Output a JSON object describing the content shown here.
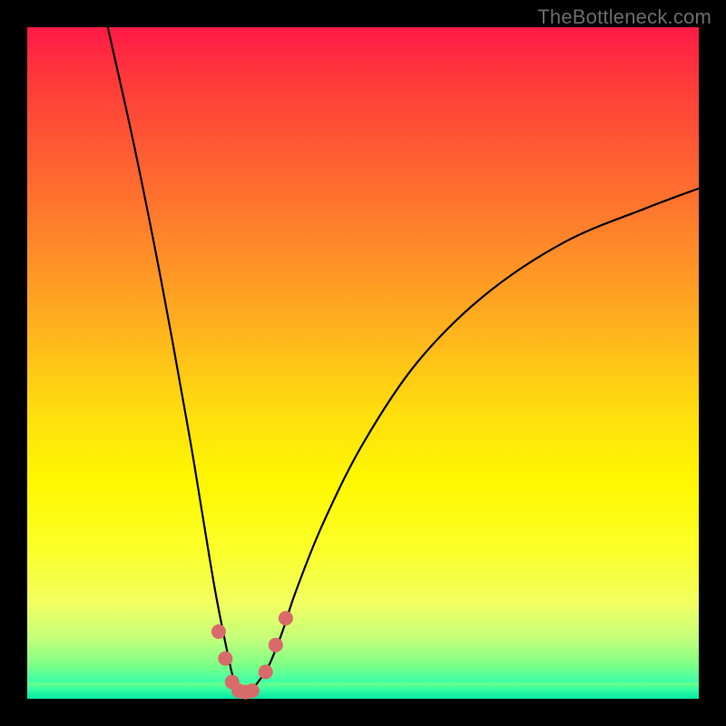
{
  "watermark": "TheBottleneck.com",
  "chart_data": {
    "type": "line",
    "title": "",
    "xlabel": "",
    "ylabel": "",
    "xlim": [
      0,
      100
    ],
    "ylim": [
      0,
      100
    ],
    "series": [
      {
        "name": "bottleneck-curve",
        "x": [
          12,
          16,
          20,
          24,
          26,
          28,
          30,
          31,
          32,
          33,
          34,
          36,
          38,
          40,
          44,
          50,
          58,
          68,
          80,
          92,
          100
        ],
        "values": [
          100,
          82,
          62,
          40,
          28,
          16,
          6,
          2,
          1,
          1,
          2,
          5,
          10,
          16,
          26,
          38,
          50,
          60,
          68,
          73,
          76
        ]
      }
    ],
    "markers": {
      "name": "highlight-points",
      "color": "#d96a6a",
      "radius": 8,
      "points": [
        {
          "x": 28.5,
          "y": 10
        },
        {
          "x": 29.5,
          "y": 6
        },
        {
          "x": 30.5,
          "y": 2.5
        },
        {
          "x": 31.5,
          "y": 1.2
        },
        {
          "x": 32.5,
          "y": 1.0
        },
        {
          "x": 33.5,
          "y": 1.2
        },
        {
          "x": 35.5,
          "y": 4
        },
        {
          "x": 37.0,
          "y": 8
        },
        {
          "x": 38.5,
          "y": 12
        }
      ]
    },
    "background": {
      "type": "vertical-gradient",
      "stops": [
        {
          "pos": 0.0,
          "color": "#ff1a47"
        },
        {
          "pos": 0.38,
          "color": "#ff9b24"
        },
        {
          "pos": 0.68,
          "color": "#fff800"
        },
        {
          "pos": 0.95,
          "color": "#7dff86"
        },
        {
          "pos": 1.0,
          "color": "#00e6a3"
        }
      ]
    }
  }
}
